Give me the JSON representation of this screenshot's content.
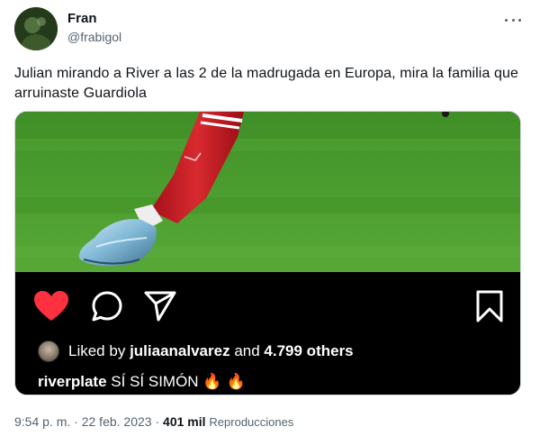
{
  "author": {
    "display_name": "Fran",
    "handle": "@frabigol",
    "avatar_icon": "profile-avatar"
  },
  "tweet": {
    "text": "Julian mirando a River a las 2 de la madrugada en Europa, mira la familia que arruinaste Guardiola"
  },
  "media": {
    "photo_icon": "soccer-player-leg-photo",
    "instagram": {
      "liked_prefix": "Liked by",
      "liked_user": "juliaanalvarez",
      "liked_and": "and",
      "liked_count": "4.799 others",
      "caption_user": "riverplate",
      "caption_text": "SÍ SÍ SIMÓN",
      "caption_emojis": "🔥 🔥",
      "heart_color": "#ff3040"
    }
  },
  "footer": {
    "time": "9:54 p. m.",
    "separator": "·",
    "date": "22 feb. 2023",
    "views_count": "401 mil",
    "views_label": "Reproducciones"
  },
  "colors": {
    "text_primary": "#0f1419",
    "text_secondary": "#536471",
    "ig_background": "#000000",
    "grass_green": "#4a9a2c"
  }
}
